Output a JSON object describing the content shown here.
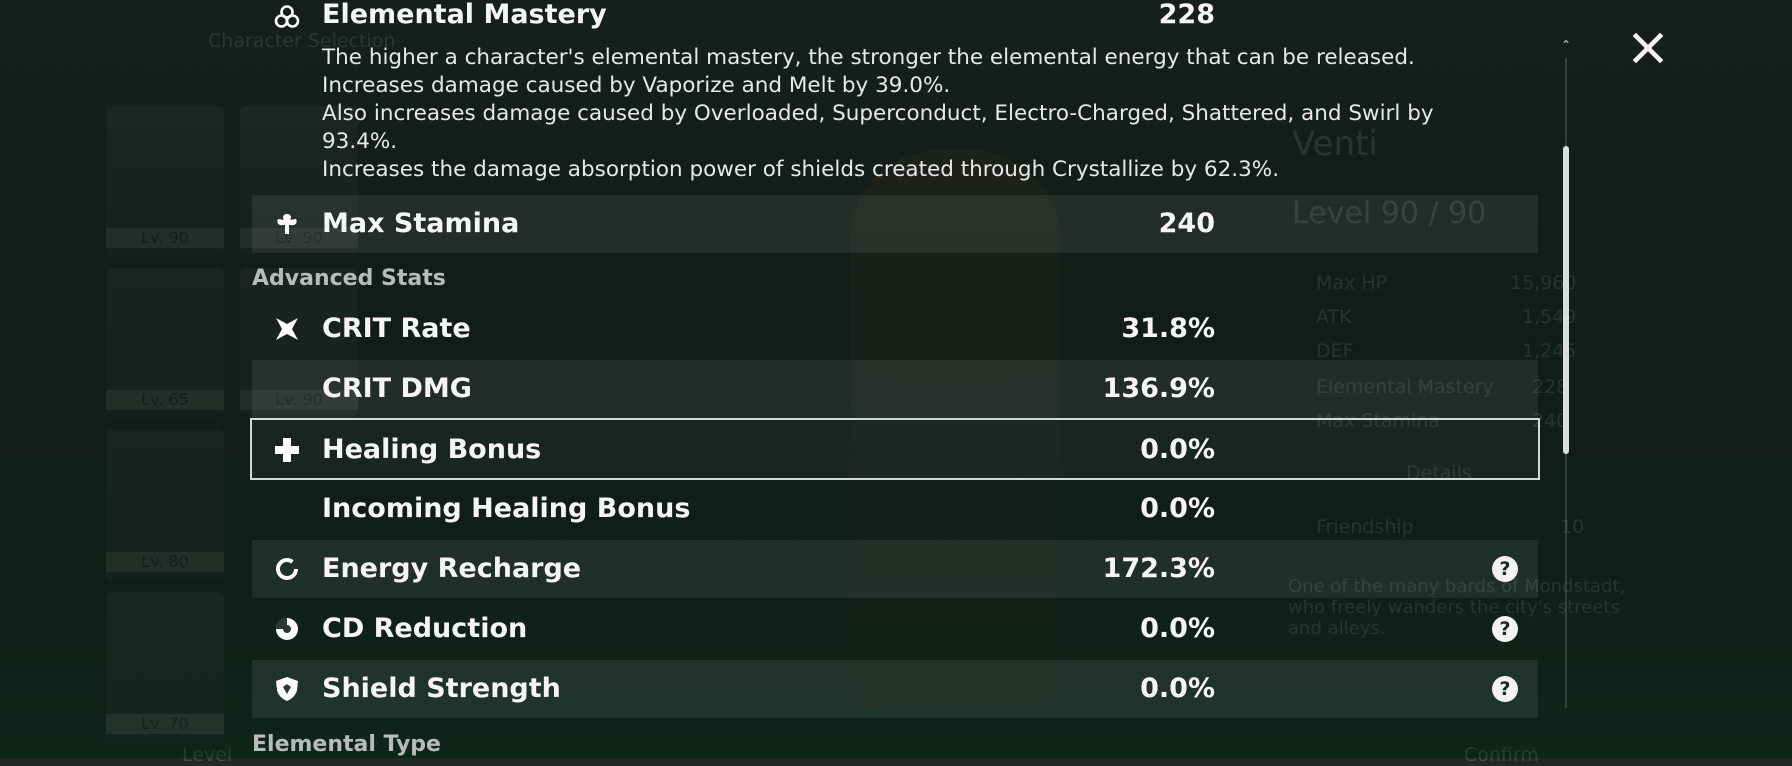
{
  "background": {
    "roster_levels": [
      "Lv. 90",
      "Lv. 90",
      "Lv. 65",
      "Lv. 90",
      "Lv. 80",
      "Lv. 70"
    ],
    "roster_header": "Character Selection",
    "character_name": "Venti",
    "character_level": "Level 90",
    "character_level_max": "/ 90",
    "summary_stats": [
      {
        "label": "Max HP",
        "value": "15,960"
      },
      {
        "label": "ATK",
        "value": "1,549"
      },
      {
        "label": "DEF",
        "value": "1,245"
      },
      {
        "label": "Elemental Mastery",
        "value": "228"
      },
      {
        "label": "Max Stamina",
        "value": "240"
      }
    ],
    "details_label": "Details",
    "friendship_label": "Friendship",
    "friendship_value": "10",
    "bio": "One of the many bards of Mondstadt, who freely wanders the city's streets and alleys.",
    "bottom_left": "Level",
    "bottom_right": "Confirm"
  },
  "elemental_mastery": {
    "label": "Elemental Mastery",
    "value": "228",
    "description": [
      "The higher a character's elemental mastery, the stronger the elemental energy that can be released.",
      "Increases damage caused by Vaporize and Melt by 39.0%.",
      "Also increases damage caused by Overloaded, Superconduct, Electro-Charged, Shattered, and Swirl by 93.4%.",
      "Increases the damage absorption power of shields created through Crystallize by 62.3%."
    ]
  },
  "max_stamina": {
    "label": "Max Stamina",
    "value": "240"
  },
  "sections": {
    "advanced": "Advanced Stats",
    "elemental": "Elemental Type"
  },
  "advanced_stats": [
    {
      "label": "CRIT Rate",
      "value": "31.8%",
      "icon": "crit-rate-icon",
      "help": false
    },
    {
      "label": "CRIT DMG",
      "value": "136.9%",
      "icon": "",
      "help": false
    },
    {
      "label": "Healing Bonus",
      "value": "0.0%",
      "icon": "healing-cross-icon",
      "help": false
    },
    {
      "label": "Incoming Healing Bonus",
      "value": "0.0%",
      "icon": "",
      "help": false
    },
    {
      "label": "Energy Recharge",
      "value": "172.3%",
      "icon": "energy-recharge-icon",
      "help": true
    },
    {
      "label": "CD Reduction",
      "value": "0.0%",
      "icon": "cd-reduction-icon",
      "help": true
    },
    {
      "label": "Shield Strength",
      "value": "0.0%",
      "icon": "shield-icon",
      "help": true
    }
  ],
  "help_glyph": "?",
  "scroll_up_glyph": "⌃"
}
